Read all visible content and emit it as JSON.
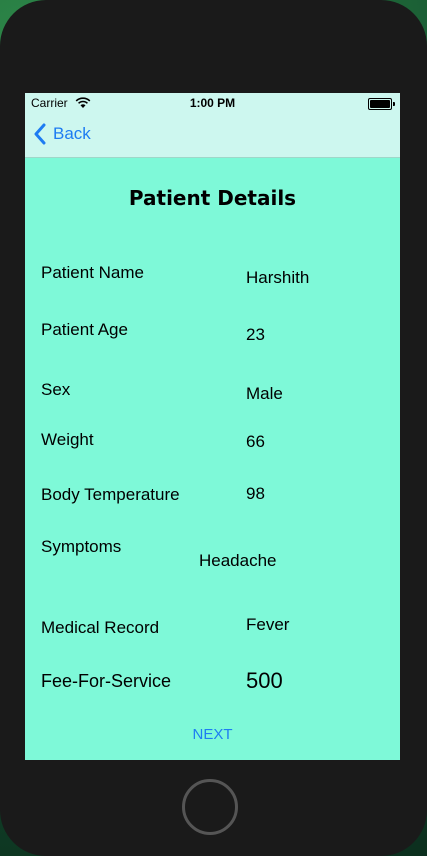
{
  "status_bar": {
    "carrier": "Carrier",
    "time": "1:00 PM"
  },
  "nav": {
    "back_label": "Back"
  },
  "page_title": "Patient Details",
  "fields": [
    {
      "label": "Patient Name",
      "value": "Harshith"
    },
    {
      "label": "Patient Age",
      "value": "23"
    },
    {
      "label": "Sex",
      "value": "Male"
    },
    {
      "label": "Weight",
      "value": "66"
    },
    {
      "label": "Body Temperature",
      "value": "98"
    },
    {
      "label": "Symptoms",
      "value": "Headache"
    },
    {
      "label": "Medical Record",
      "value": "Fever"
    },
    {
      "label": "Fee-For-Service",
      "value": "500"
    }
  ],
  "actions": {
    "next_label": "NEXT"
  },
  "colors": {
    "background": "#7ef9d8",
    "accent": "#1e7cf2",
    "nav_bg": "#cdf7ef"
  }
}
